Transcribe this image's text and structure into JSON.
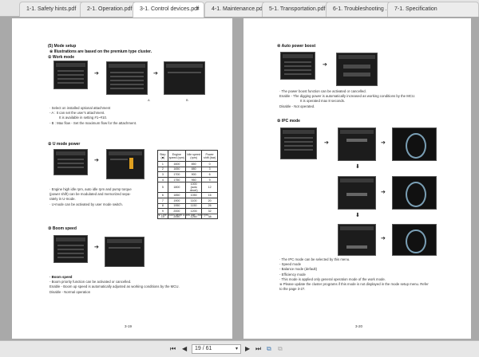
{
  "tabs": [
    {
      "label": "1-1. Safety hints.pdf"
    },
    {
      "label": "2-1. Operation.pdf"
    },
    {
      "label": "3-1. Control devices.pdf",
      "active": true,
      "close": "×"
    },
    {
      "label": "4-1. Maintenance.pdf"
    },
    {
      "label": "5-1. Transportation.pdf"
    },
    {
      "label": "6-1. Troubleshooting ..."
    },
    {
      "label": "7-1. Specification"
    }
  ],
  "left_page": {
    "heading": "(5) Mode setup",
    "note": "※ Illustrations are based on the premium type cluster.",
    "work_mode": {
      "title": "① Work mode",
      "cap_a": "A",
      "cap_b": "B",
      "lines": [
        "· Select on installed optional attachment",
        "  - A : It can set the user's attachment.",
        "       It is available in setting #1~#10.",
        "  - B : Max flow - Set the maximum flow for the attachment."
      ]
    },
    "u_mode": {
      "title": "② U mode power",
      "lines": [
        "· Engine high idle rpm, auto idle rpm and pump torque",
        "  (power shift) can be modulated and memorized sepa-",
        "  rately in U-mode.",
        "· U-mode can be activated by user mode switch."
      ],
      "table": {
        "headers": [
          "Step (■)",
          "Engine speed (rpm)",
          "Idle speed (rpm)",
          "Power shift (bar)"
        ],
        "rows": [
          [
            "1",
            "1600",
            "850",
            "0"
          ],
          [
            "2",
            "1650",
            "880",
            "3"
          ],
          [
            "3",
            "1700",
            "900",
            "6"
          ],
          [
            "4",
            "1750",
            "950",
            "9"
          ],
          [
            "5",
            "1800",
            "1000 (auto decel)",
            "12"
          ],
          [
            "6",
            "1850",
            "1050",
            "16"
          ],
          [
            "7",
            "1900",
            "1100",
            "20"
          ],
          [
            "8",
            "1950",
            "1150",
            "26"
          ],
          [
            "9",
            "2000",
            "1200",
            "32"
          ],
          [
            "10",
            "2050",
            "1250",
            "38"
          ]
        ],
        "footnote": "※ One touch decel & low idle : 850 rpm"
      }
    },
    "boom": {
      "title": "③ Boom speed",
      "sub": "· Boom speed",
      "lines": [
        "  - Boom priority function can be activated or cancelled.",
        "    Enable - Boom up speed is automatically adjusted as working conditions by the MCU.",
        "    Disable - Normal operation"
      ]
    },
    "page_number": "3-19"
  },
  "right_page": {
    "auto_boost": {
      "title": "④ Auto power boost",
      "lines": [
        "· The power boost function can be activated or cancelled.",
        "  Enable - The digging power is automatically increased as working conditions by the MCU.",
        "            It is operated max 8 seconds.",
        "  Disable - Not operated."
      ]
    },
    "ipc": {
      "title": "⑤ IPC mode",
      "lines": [
        "· The IPC mode can be selected by this menu.",
        "  - Speed mode",
        "  - Balance mode (default)",
        "  - Efficiency mode",
        "· This mode is applied only general operation mode of the work mode.",
        "※ Please update the cluster programs if this mode is not displayed in the mode setup menu. Refer",
        "   to the page 3-27."
      ]
    },
    "page_number": "3-20"
  },
  "toolbar": {
    "page_value": "19 / 61"
  }
}
